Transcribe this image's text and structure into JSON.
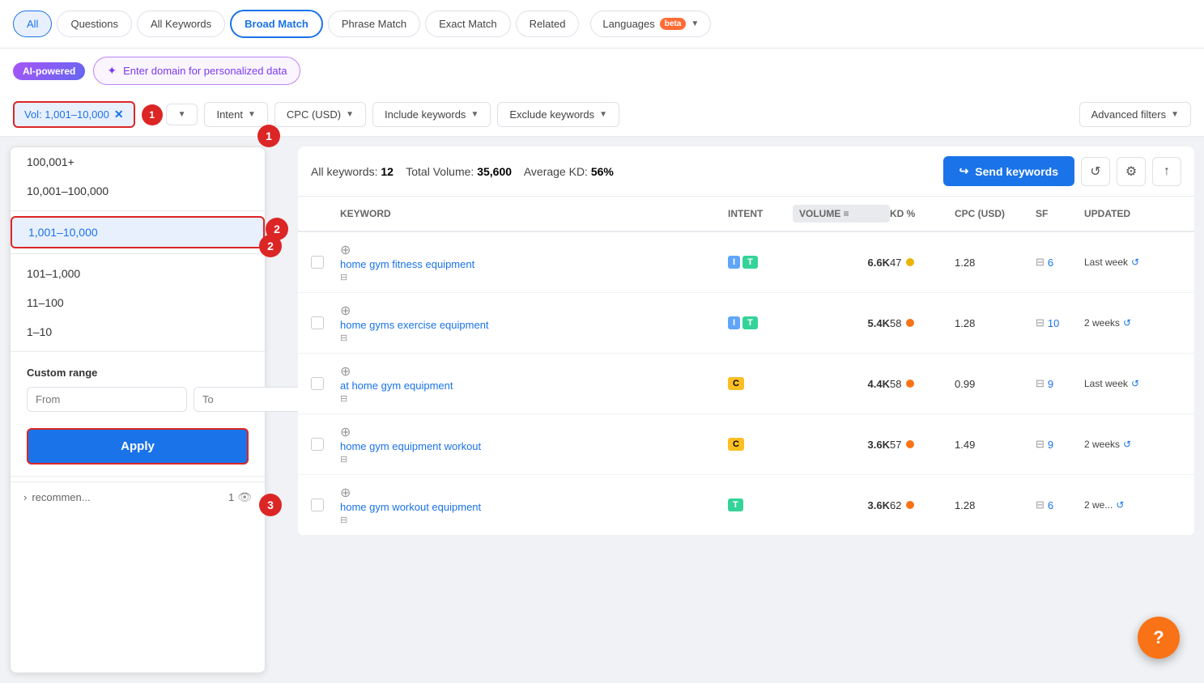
{
  "tabs": {
    "items": [
      {
        "label": "All",
        "active": true
      },
      {
        "label": "Questions",
        "active": false
      },
      {
        "label": "All Keywords",
        "active": false
      },
      {
        "label": "Broad Match",
        "selected": true
      },
      {
        "label": "Phrase Match",
        "active": false
      },
      {
        "label": "Exact Match",
        "active": false
      },
      {
        "label": "Related",
        "active": false
      }
    ],
    "languages_label": "Languages",
    "beta_label": "beta"
  },
  "ai_row": {
    "badge_label": "AI-powered",
    "domain_placeholder": "Enter domain for personalized data"
  },
  "filters": {
    "vol_label": "Vol: 1,001–10,000",
    "kd_number": "1",
    "intent_label": "Intent",
    "cpc_label": "CPC (USD)",
    "include_label": "Include keywords",
    "exclude_label": "Exclude keywords",
    "advanced_label": "Advanced filters"
  },
  "dropdown": {
    "options": [
      {
        "label": "100,001+",
        "selected": false
      },
      {
        "label": "10,001–100,000",
        "selected": false
      },
      {
        "label": "1,001–10,000",
        "selected": true
      },
      {
        "label": "101–1,000",
        "selected": false
      },
      {
        "label": "11–100",
        "selected": false
      },
      {
        "label": "1–10",
        "selected": false
      }
    ],
    "custom_range_label": "Custom range",
    "from_placeholder": "From",
    "to_placeholder": "To",
    "apply_label": "Apply",
    "footer_label": "recommen...",
    "footer_count": "1"
  },
  "stats": {
    "all_keywords_label": "All keywords:",
    "all_keywords_value": "12",
    "total_volume_label": "Total Volume:",
    "total_volume_value": "35,600",
    "avg_kd_label": "Average KD:",
    "avg_kd_value": "56%",
    "send_keywords_label": "Send keywords"
  },
  "table": {
    "headers": [
      "",
      "Keyword",
      "Intent",
      "Volume",
      "KD %",
      "CPC (USD)",
      "SF",
      "Updated"
    ],
    "rows": [
      {
        "keyword": "home gym fitness equipment",
        "intent": [
          "I",
          "T"
        ],
        "volume": "6.6K",
        "kd": "47",
        "kd_color": "yellow",
        "cpc": "1.28",
        "sf": "6",
        "updated": "Last week"
      },
      {
        "keyword": "home gyms exercise equipment",
        "intent": [
          "I",
          "T"
        ],
        "volume": "5.4K",
        "kd": "58",
        "kd_color": "orange",
        "cpc": "1.28",
        "sf": "10",
        "updated": "2 weeks"
      },
      {
        "keyword": "at home gym equipment",
        "intent": [
          "C"
        ],
        "volume": "4.4K",
        "kd": "58",
        "kd_color": "orange",
        "cpc": "0.99",
        "sf": "9",
        "updated": "Last week"
      },
      {
        "keyword": "home gym equipment workout",
        "intent": [
          "C"
        ],
        "volume": "3.6K",
        "kd": "57",
        "kd_color": "orange",
        "cpc": "1.49",
        "sf": "9",
        "updated": "2 weeks"
      },
      {
        "keyword": "home gym workout equipment",
        "intent": [
          "T"
        ],
        "volume": "3.6K",
        "kd": "62",
        "kd_color": "orange",
        "cpc": "1.28",
        "sf": "6",
        "updated": "2 we..."
      }
    ]
  }
}
